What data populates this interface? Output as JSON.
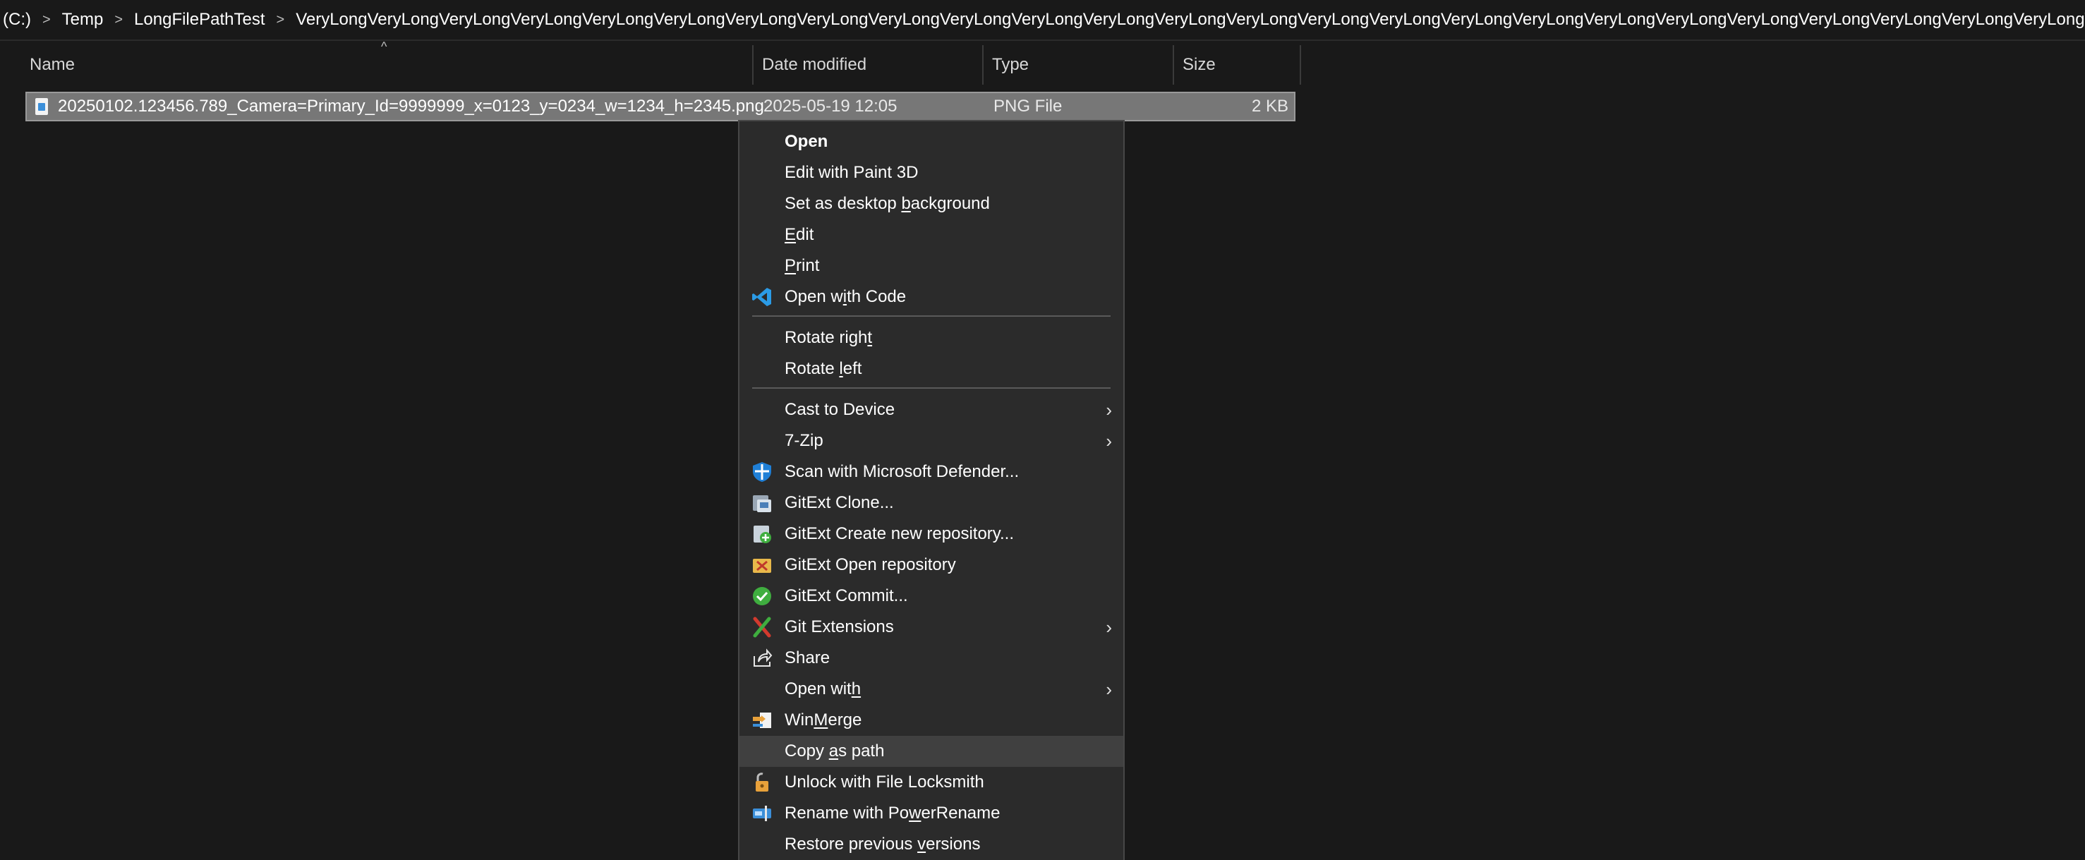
{
  "breadcrumb": {
    "items": [
      "(C:)",
      "Temp",
      "LongFilePathTest",
      "VeryLongVeryLongVeryLongVeryLongVeryLongVeryLongVeryLongVeryLongVeryLongVeryLongVeryLongVeryLongVeryLongVeryLongVeryLongVeryLongVeryLongVeryLongVeryLongVeryLongVeryLongVeryLongVeryLongVeryLongVeryLongVeryLongVeryLongVery"
    ],
    "separator": ">"
  },
  "columns": {
    "name": "Name",
    "date_modified": "Date modified",
    "type": "Type",
    "size": "Size",
    "sort_indicator": "^"
  },
  "file": {
    "name": "20250102.123456.789_Camera=Primary_Id=9999999_x=0123_y=0234_w=1234_h=2345.png",
    "date_modified": "2025-05-19 12:05",
    "type": "PNG File",
    "size": "2 KB"
  },
  "menu": {
    "open": "Open",
    "edit_paint3d": "Edit with Paint 3D",
    "set_bg_pre": "Set as desktop ",
    "set_bg_u": "b",
    "set_bg_post": "ackground",
    "edit_u": "E",
    "edit_post": "dit",
    "print_u": "P",
    "print_post": "rint",
    "open_code_pre": "Open w",
    "open_code_u": "i",
    "open_code_post": "th Code",
    "rotate_right_pre": "Rotate righ",
    "rotate_right_u": "t",
    "rotate_left_pre": "Rotate ",
    "rotate_left_u": "l",
    "rotate_left_post": "eft",
    "cast": "Cast to Device",
    "seven_zip": "7-Zip",
    "defender": "Scan with Microsoft Defender...",
    "gitext_clone": "GitExt Clone...",
    "gitext_create": "GitExt Create new repository...",
    "gitext_open": "GitExt Open repository",
    "gitext_commit": "GitExt Commit...",
    "git_extensions": "Git Extensions",
    "share": "Share",
    "open_with_pre": "Open wit",
    "open_with_u": "h",
    "winmerge_pre": "Win",
    "winmerge_u": "M",
    "winmerge_post": "erge",
    "copy_path_pre": "Copy ",
    "copy_path_u": "a",
    "copy_path_post": "s path",
    "locksmith": "Unlock with File Locksmith",
    "powerrename_pre": "Rename with Po",
    "powerrename_u": "w",
    "powerrename_post": "erRename",
    "restore_pre": "Restore previous ",
    "restore_u": "v",
    "restore_post": "ersions"
  },
  "colors": {
    "background": "#191919",
    "menu_bg": "#2b2b2b",
    "selection": "#777777",
    "accent": "#3b8fd9"
  }
}
